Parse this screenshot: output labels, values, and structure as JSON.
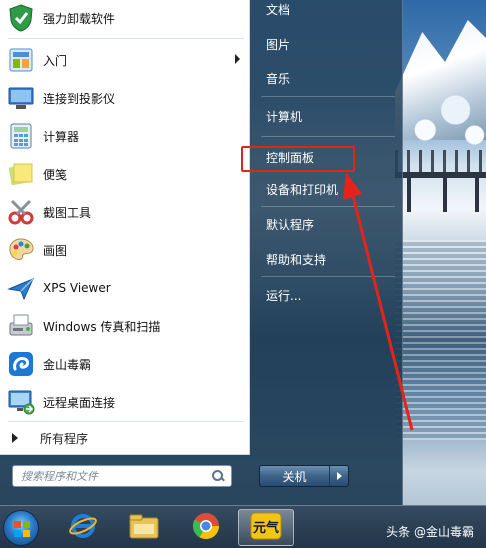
{
  "start_menu": {
    "apps": [
      {
        "label": "强力卸载软件",
        "icon": "uninstaller-shield-icon",
        "color": "#2f9a48"
      },
      {
        "label": "入门",
        "icon": "getting-started-icon",
        "color": "#4a90d9",
        "has_submenu": true
      },
      {
        "label": "连接到投影仪",
        "icon": "projector-icon",
        "color": "#3a7bd5"
      },
      {
        "label": "计算器",
        "icon": "calculator-icon",
        "color": "#5b9bd5"
      },
      {
        "label": "便笺",
        "icon": "sticky-notes-icon",
        "color": "#f2e36b"
      },
      {
        "label": "截图工具",
        "icon": "scissors-icon",
        "color": "#d23a3a"
      },
      {
        "label": "画图",
        "icon": "paint-palette-icon",
        "color": "#e8a33c"
      },
      {
        "label": "XPS Viewer",
        "icon": "xps-viewer-icon",
        "color": "#2b7bd0"
      },
      {
        "label": "Windows 传真和扫描",
        "icon": "fax-scanner-icon",
        "color": "#8a8f96"
      },
      {
        "label": "金山毒霸",
        "icon": "kingsoft-antivirus-icon",
        "color": "#1c78d3"
      },
      {
        "label": "远程桌面连接",
        "icon": "remote-desktop-icon",
        "color": "#3d86c6"
      }
    ],
    "all_programs": "所有程序",
    "search": {
      "placeholder": "搜索程序和文件"
    },
    "places": [
      {
        "label": "文档",
        "name": "place-documents"
      },
      {
        "label": "图片",
        "name": "place-pictures"
      },
      {
        "label": "音乐",
        "name": "place-music"
      },
      {
        "label": "计算机",
        "name": "place-computer"
      },
      {
        "label": "控制面板",
        "name": "place-control-panel",
        "highlighted": true
      },
      {
        "label": "设备和打印机",
        "name": "place-devices-printers"
      },
      {
        "label": "默认程序",
        "name": "place-default-programs"
      },
      {
        "label": "帮助和支持",
        "name": "place-help-support"
      },
      {
        "label": "运行...",
        "name": "place-run"
      }
    ],
    "shutdown_label": "关机"
  },
  "taskbar": {
    "items": [
      {
        "name": "ie-icon",
        "color": "#1f7fd6"
      },
      {
        "name": "file-explorer-icon",
        "color": "#e9c35a"
      },
      {
        "name": "chrome-icon",
        "color": "#dd4b39"
      },
      {
        "name": "kingsoft-taskbar-icon",
        "color": "#f0c419"
      }
    ],
    "watermark": "头条 @金山毒霸"
  },
  "annotation": {
    "color": "#e5231b"
  }
}
